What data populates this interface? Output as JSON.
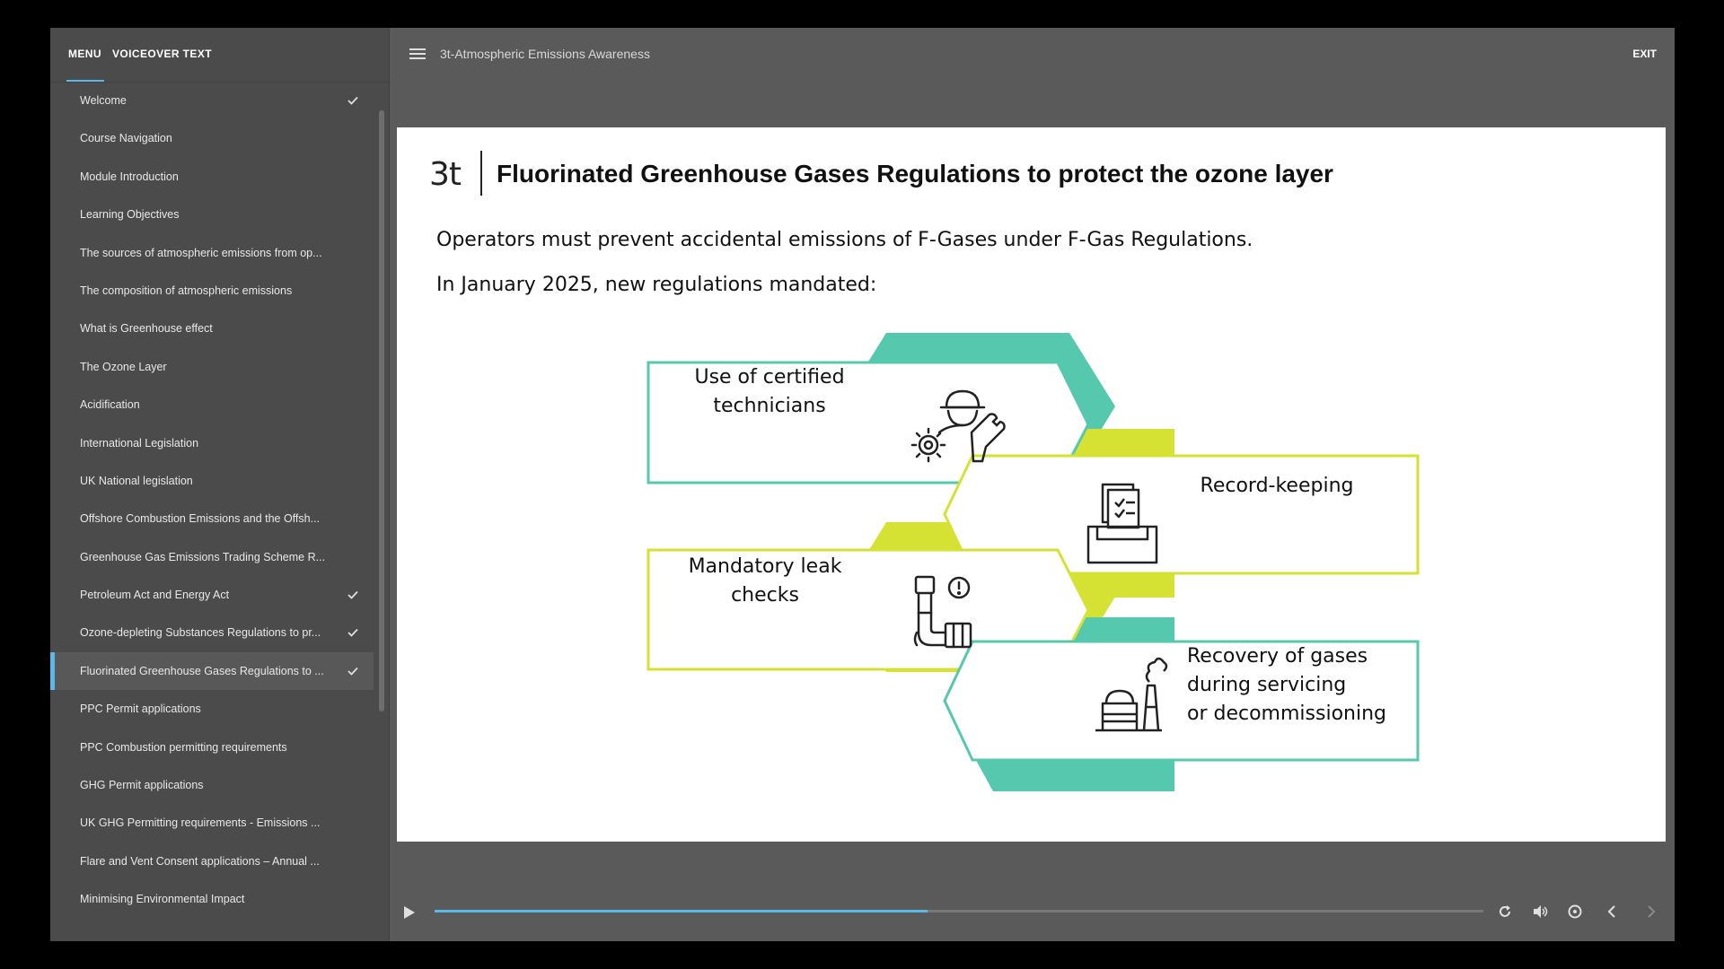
{
  "sidebar": {
    "tabs": {
      "menu": "MENU",
      "voiceover": "VOICEOVER TEXT"
    },
    "items": [
      {
        "label": "Welcome",
        "checked": true
      },
      {
        "label": "Course Navigation",
        "checked": false
      },
      {
        "label": "Module Introduction",
        "checked": false
      },
      {
        "label": "Learning Objectives",
        "checked": false
      },
      {
        "label": "The sources of atmospheric emissions from op...",
        "checked": false
      },
      {
        "label": "The composition of atmospheric emissions",
        "checked": false
      },
      {
        "label": "What is Greenhouse effect",
        "checked": false
      },
      {
        "label": "The Ozone Layer",
        "checked": false
      },
      {
        "label": "Acidification",
        "checked": false
      },
      {
        "label": "International Legislation",
        "checked": false
      },
      {
        "label": "UK National legislation",
        "checked": false
      },
      {
        "label": "Offshore Combustion Emissions and the Offsh...",
        "checked": false
      },
      {
        "label": "Greenhouse Gas Emissions Trading Scheme R...",
        "checked": false
      },
      {
        "label": "Petroleum Act and Energy Act",
        "checked": true
      },
      {
        "label": "Ozone-depleting Substances Regulations to pr...",
        "checked": true
      },
      {
        "label": "Fluorinated Greenhouse Gases Regulations to ...",
        "checked": true,
        "active": true
      },
      {
        "label": "PPC Permit applications",
        "checked": false
      },
      {
        "label": "PPC Combustion permitting requirements",
        "checked": false
      },
      {
        "label": "GHG Permit applications",
        "checked": false
      },
      {
        "label": "UK GHG Permitting requirements - Emissions ...",
        "checked": false
      },
      {
        "label": "Flare and Vent Consent applications – Annual ...",
        "checked": false
      },
      {
        "label": "Minimising Environmental Impact",
        "checked": false
      }
    ]
  },
  "topbar": {
    "course_title": "3t-Atmospheric Emissions Awareness",
    "exit_label": "EXIT"
  },
  "slide": {
    "logo": "3t",
    "title": "Fluorinated Greenhouse Gases Regulations to protect the ozone layer",
    "intro_1": "Operators must prevent accidental emissions of F-Gases under F-Gas Regulations.",
    "intro_2": "In January 2025, new regulations mandated:",
    "cards": {
      "technicians": [
        "Use of certified",
        "technicians"
      ],
      "record": [
        "Record-keeping"
      ],
      "leak": [
        "Mandatory leak",
        "checks"
      ],
      "recovery": [
        "Recovery of gases",
        "during servicing",
        "or decommissioning"
      ]
    }
  },
  "player": {
    "progress": 0.47
  },
  "colors": {
    "teal": "#55c8ad",
    "lime": "#d5e234",
    "accent": "#5db8e8"
  },
  "icons": [
    "hamburger-icon",
    "check-icon",
    "technician-gear-wrench-icon",
    "records-tray-icon",
    "pipe-leak-warning-icon",
    "gas-recovery-plant-icon",
    "play-icon",
    "replay-icon",
    "volume-icon",
    "settings-speed-icon",
    "prev-icon",
    "next-icon"
  ]
}
